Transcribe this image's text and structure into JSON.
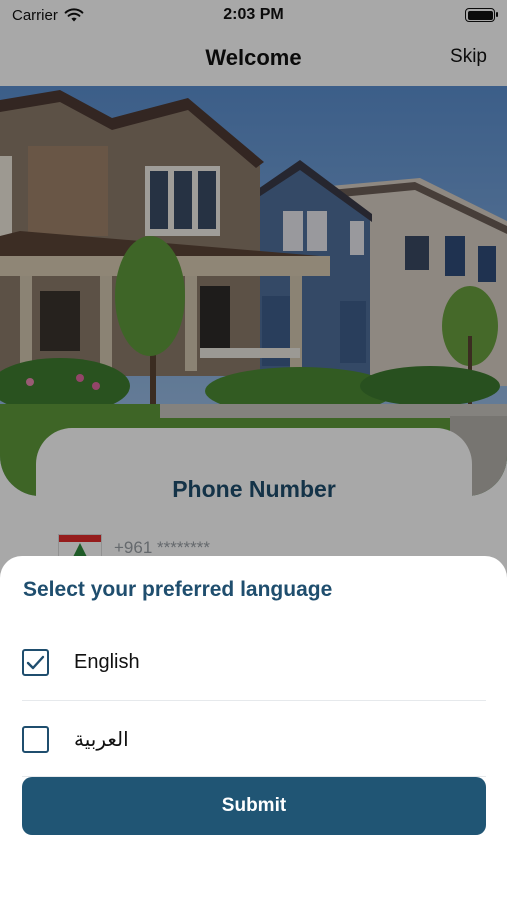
{
  "status_bar": {
    "carrier": "Carrier",
    "time": "2:03 PM"
  },
  "nav": {
    "title": "Welcome",
    "skip_label": "Skip"
  },
  "hero": {
    "icon": "house-photo"
  },
  "phone_card": {
    "title": "Phone Number",
    "placeholder": "+961 ********",
    "flag_icon": "lebanon-flag-icon"
  },
  "language_sheet": {
    "title": "Select your preferred language",
    "options": [
      {
        "label": "English",
        "checked": true
      },
      {
        "label": "العربية",
        "checked": false
      }
    ],
    "submit_label": "Submit"
  },
  "colors": {
    "accent": "#1f4e6e",
    "button": "#205574",
    "flag_red": "#e32b2b",
    "flag_green": "#2e8a3c"
  }
}
